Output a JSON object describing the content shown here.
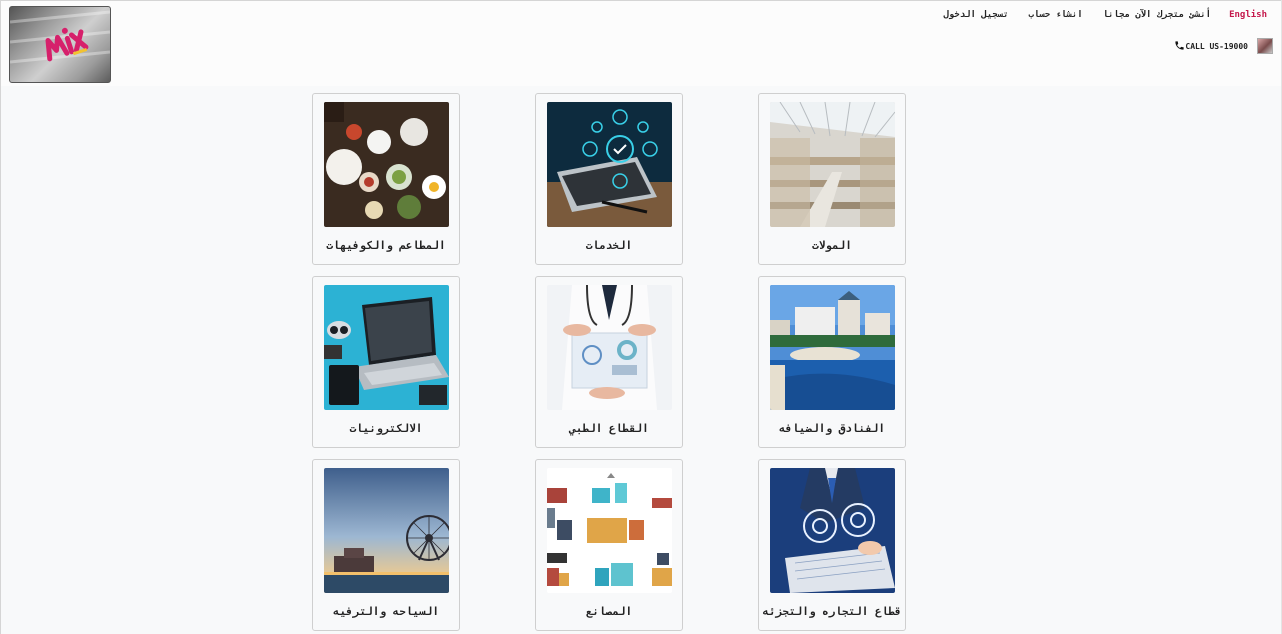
{
  "header": {
    "logo_alt": "Mix",
    "nav": {
      "language": "English",
      "open_store": "أنشئ متجرك الآن مجانا",
      "create_account": "انشاء حساب",
      "login": "تسجيل الدخول"
    },
    "call": {
      "text": "CALL US-19000",
      "icon": "phone-icon"
    }
  },
  "categories": [
    {
      "label": "المولات",
      "icon": "mall-image"
    },
    {
      "label": "الخدمات",
      "icon": "services-image"
    },
    {
      "label": "المطاعم والكوفيهات",
      "icon": "restaurants-image"
    },
    {
      "label": "الفنادق والضيافه",
      "icon": "hotels-image"
    },
    {
      "label": "القطاع الطبي",
      "icon": "medical-image"
    },
    {
      "label": "الالكترونيات",
      "icon": "electronics-image"
    },
    {
      "label": "قطاع التجاره والتجزئه",
      "icon": "trade-image"
    },
    {
      "label": "المصانع",
      "icon": "factories-image"
    },
    {
      "label": "السياحه والترفيه",
      "icon": "tourism-image"
    }
  ]
}
